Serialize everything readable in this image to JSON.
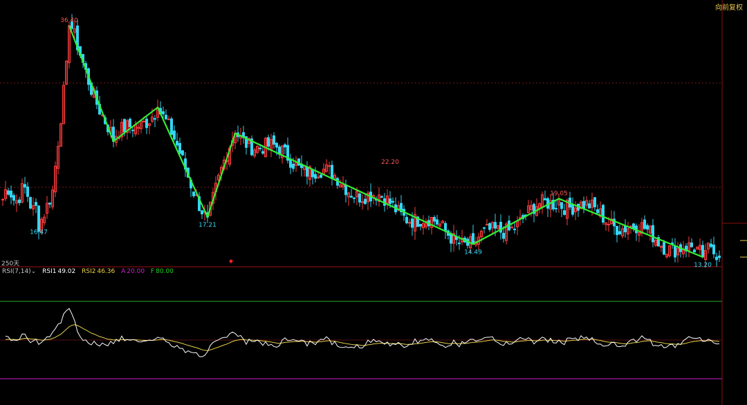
{
  "header": {
    "rights_label": "向前复权",
    "period_label": "250天"
  },
  "indicator": {
    "name": "RSI(7,14)",
    "rsi1_label": "RSI1",
    "rsi1_value": "49.02",
    "rsi2_label": "RSI2",
    "rsi2_value": "46.36",
    "a_label": "A",
    "a_value": "20.00",
    "f_label": "F",
    "f_value": "80.00"
  },
  "colors": {
    "background": "#000000",
    "up": "#ff3b3b",
    "down": "#33d6f2",
    "zigzag": "#33ee33",
    "grid": "#7a1a1a",
    "rsi1": "#ffffff",
    "rsi2": "#e8d24a",
    "line_a": "#cc22cc",
    "line_f": "#22aa22"
  },
  "chart_data": [
    {
      "type": "candlestick",
      "ylim": [
        12.5,
        38
      ],
      "price_labels": [
        {
          "i": 24,
          "value": "36.40"
        },
        {
          "i": 13,
          "value": "16.47"
        },
        {
          "i": 74,
          "value": "17.21"
        },
        {
          "i": 140,
          "value": "22.20"
        },
        {
          "i": 170,
          "value": "14.49"
        },
        {
          "i": 201,
          "value": "19.05"
        },
        {
          "i": 253,
          "value": "13.20"
        }
      ],
      "zigzag": [
        {
          "i": 24,
          "price": 36.4
        },
        {
          "i": 40,
          "price": 24.8
        },
        {
          "i": 56,
          "price": 28.2
        },
        {
          "i": 74,
          "price": 17.21
        },
        {
          "i": 84,
          "price": 25.6
        },
        {
          "i": 170,
          "price": 14.49
        },
        {
          "i": 201,
          "price": 19.05
        },
        {
          "i": 253,
          "price": 13.2
        }
      ]
    },
    {
      "type": "line",
      "ylim": [
        0,
        100
      ],
      "series": [
        {
          "name": "RSI1"
        },
        {
          "name": "RSI2"
        }
      ],
      "reference_lines": [
        {
          "name": "A",
          "value": 20
        },
        {
          "name": "F",
          "value": 80
        }
      ]
    }
  ]
}
